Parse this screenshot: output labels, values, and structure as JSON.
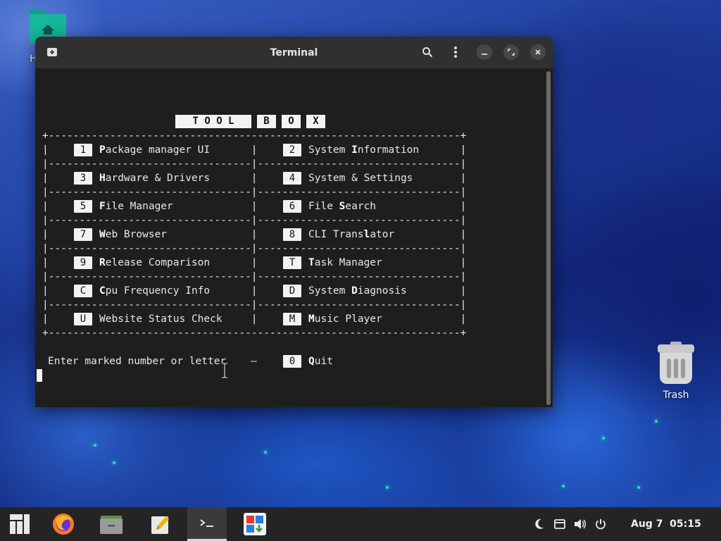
{
  "desktop": {
    "home_label": "H",
    "trash_label": "Trash"
  },
  "window": {
    "title": "Terminal",
    "icons": [
      "new-tab-icon",
      "search-icon",
      "menu-icon",
      "minimize-icon",
      "maximize-icon",
      "close-icon"
    ]
  },
  "terminal": {
    "heading": [
      "T O O L",
      "B",
      "O",
      "X"
    ],
    "border_top": "+-------------------------------------------------------------------+",
    "border_mid": "|---------------------------------|---------------------------------|",
    "border_bottom": "+-------------------------------------------------------------------+",
    "menu_items": [
      {
        "key": "1",
        "first": "P",
        "rest": "ackage manager UI",
        "pre": ""
      },
      {
        "key": "2",
        "first": "I",
        "rest": "nformation",
        "pre": "System "
      },
      {
        "key": "3",
        "first": "H",
        "rest": "ardware & Drivers",
        "pre": ""
      },
      {
        "key": "4",
        "first": "",
        "rest": "System & Settings",
        "pre": ""
      },
      {
        "key": "5",
        "first": "F",
        "rest": "ile Manager",
        "pre": ""
      },
      {
        "key": "6",
        "first": "S",
        "rest": "earch",
        "pre": "File "
      },
      {
        "key": "7",
        "first": "W",
        "rest": "eb Browser",
        "pre": ""
      },
      {
        "key": "8",
        "first": "l",
        "rest": "ator",
        "pre": "CLI Trans"
      },
      {
        "key": "9",
        "first": "R",
        "rest": "elease Comparison",
        "pre": ""
      },
      {
        "key": "T",
        "first": "T",
        "rest": "ask Manager",
        "pre": ""
      },
      {
        "key": "C",
        "first": "C",
        "rest": "pu Frequency Info",
        "pre": ""
      },
      {
        "key": "D",
        "first": "D",
        "rest": "iagnosis",
        "pre": "System "
      },
      {
        "key": "U",
        "first": "",
        "rest": "Website Status Check",
        "pre": ""
      },
      {
        "key": "M",
        "first": "M",
        "rest": "usic Player",
        "pre": ""
      }
    ],
    "prompt_text": "Enter marked number or letter",
    "prompt_dash": "–",
    "quit_key": "0",
    "quit_first": "Q",
    "quit_rest": "uit"
  },
  "taskbar": {
    "apps": [
      "manjaro-menu-icon",
      "firefox-icon",
      "files-icon",
      "text-editor-icon",
      "terminal-icon",
      "software-center-icon"
    ],
    "active_app": "terminal-icon",
    "tray": [
      "night-light-icon",
      "clipboard-icon",
      "volume-icon",
      "power-icon"
    ],
    "clock": "Aug 7  05:15"
  }
}
